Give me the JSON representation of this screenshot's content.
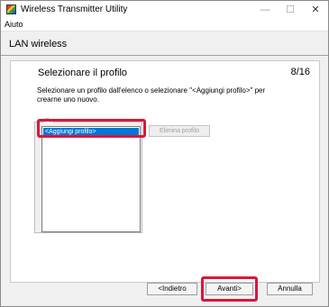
{
  "window": {
    "title": "Wireless Transmitter Utility",
    "controls": {
      "minimize": "—",
      "maximize": "☐",
      "close": "✕"
    }
  },
  "menu": {
    "items": [
      "Aiuto"
    ]
  },
  "header": {
    "title": "LAN wireless"
  },
  "page": {
    "title": "Selezionare il profilo",
    "counter": "8/16",
    "description": "Selezionare un profilo dall'elenco o selezionare \"<Aggiungi profilo>\" per crearne uno nuovo."
  },
  "profiles": {
    "group_label": "Pr",
    "items": [
      "<Aggiungi profilo>"
    ],
    "delete_label": "Elimina profilo"
  },
  "buttons": {
    "back": "<Indietro",
    "next": "Avanti>",
    "cancel": "Annulla"
  },
  "colors": {
    "highlight": "#d8173b",
    "selection": "#0078d7"
  },
  "icons": {
    "app": "wireless-transmitter-app-icon",
    "minimize": "minimize-icon",
    "maximize": "maximize-icon",
    "close": "close-icon"
  }
}
